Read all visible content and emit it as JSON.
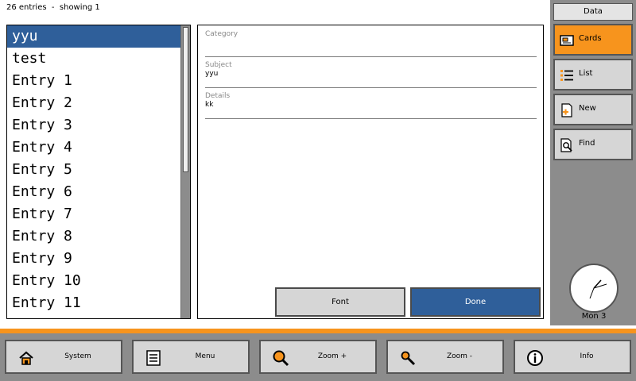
{
  "status": {
    "count_text": "26 entries  -  showing 1"
  },
  "entries": [
    {
      "label": "yyu",
      "selected": true
    },
    {
      "label": "test"
    },
    {
      "label": "Entry 1"
    },
    {
      "label": "Entry 2"
    },
    {
      "label": "Entry 3"
    },
    {
      "label": "Entry 4"
    },
    {
      "label": "Entry 5"
    },
    {
      "label": "Entry 6"
    },
    {
      "label": "Entry 7"
    },
    {
      "label": "Entry 8"
    },
    {
      "label": "Entry 9"
    },
    {
      "label": "Entry 10"
    },
    {
      "label": "Entry 11"
    }
  ],
  "card": {
    "category_label": "Category",
    "category_value": "",
    "subject_label": "Subject",
    "subject_value": "yyu",
    "details_label": "Details",
    "details_value": "kk",
    "font_label": "Font",
    "done_label": "Done"
  },
  "sidebar": {
    "header": "Data",
    "buttons": [
      {
        "label": "Cards",
        "icon": "cards-icon",
        "active": true
      },
      {
        "label": "List",
        "icon": "list-icon"
      },
      {
        "label": "New",
        "icon": "new-icon"
      },
      {
        "label": "Find",
        "icon": "find-icon"
      }
    ],
    "clock_day": "Mon 3"
  },
  "bottom": {
    "buttons": [
      {
        "label": "System",
        "icon": "home-icon"
      },
      {
        "label": "Menu",
        "icon": "menu-icon"
      },
      {
        "label": "Zoom +",
        "icon": "zoom-in-icon"
      },
      {
        "label": "Zoom -",
        "icon": "zoom-out-icon"
      },
      {
        "label": "Info",
        "icon": "info-icon"
      }
    ]
  },
  "colors": {
    "accent": "#f7941d",
    "selection": "#2f5f9a",
    "chrome": "#8c8c8c",
    "button": "#d6d6d6"
  }
}
